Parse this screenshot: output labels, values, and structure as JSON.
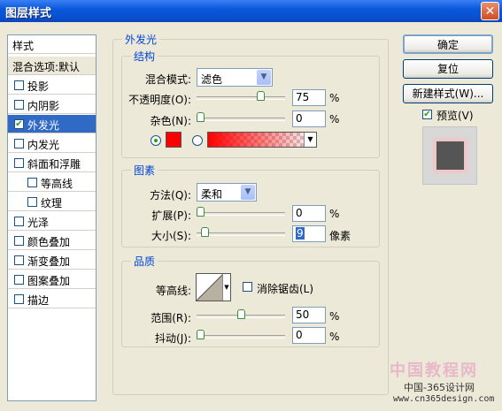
{
  "window": {
    "title": "图层样式",
    "close_glyph": "✕"
  },
  "sidebar": {
    "header": "样式",
    "blend_default": "混合选项:默认",
    "items": [
      {
        "label": "投影",
        "checked": false
      },
      {
        "label": "内阴影",
        "checked": false
      },
      {
        "label": "外发光",
        "checked": true,
        "selected": true
      },
      {
        "label": "内发光",
        "checked": false
      },
      {
        "label": "斜面和浮雕",
        "checked": false
      },
      {
        "label": "等高线",
        "checked": false,
        "indent": true
      },
      {
        "label": "纹理",
        "checked": false,
        "indent": true
      },
      {
        "label": "光泽",
        "checked": false
      },
      {
        "label": "颜色叠加",
        "checked": false
      },
      {
        "label": "渐变叠加",
        "checked": false
      },
      {
        "label": "图案叠加",
        "checked": false
      },
      {
        "label": "描边",
        "checked": false
      }
    ]
  },
  "outer_glow": {
    "title": "外发光",
    "structure": {
      "title": "结构",
      "blend_mode_label": "混合模式:",
      "blend_mode_value": "滤色",
      "opacity_label": "不透明度(O):",
      "opacity_value": "75",
      "opacity_level": 0.75,
      "noise_label": "杂色(N):",
      "noise_value": "0",
      "noise_level": 0,
      "percent": "%",
      "glow_color": "#ff0000"
    },
    "elements": {
      "title": "图素",
      "technique_label": "方法(Q):",
      "technique_value": "柔和",
      "spread_label": "扩展(P):",
      "spread_value": "0",
      "spread_level": 0,
      "size_label": "大小(S):",
      "size_value": "9",
      "size_level": 0.05,
      "size_unit": "像素",
      "percent": "%"
    },
    "quality": {
      "title": "品质",
      "contour_label": "等高线:",
      "anti_alias_label": "消除锯齿(L)",
      "range_label": "范围(R):",
      "range_value": "50",
      "range_level": 0.5,
      "jitter_label": "抖动(J):",
      "jitter_value": "0",
      "jitter_level": 0,
      "percent": "%"
    }
  },
  "buttons": {
    "ok": "确定",
    "reset": "复位",
    "new_style": "新建样式(W)...",
    "preview": "预览(V)"
  },
  "watermark": {
    "line1": "中国教程网",
    "line2": "中国-365设计网",
    "line3": "www.cn365design.com"
  },
  "colors": {
    "selection": "#316ac5",
    "group_title": "#0046d5",
    "glow": "#ff0000"
  }
}
